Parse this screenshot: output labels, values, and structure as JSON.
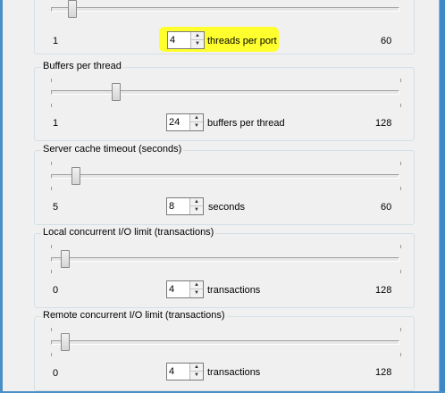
{
  "panels": [
    {
      "legend": "",
      "min": "1",
      "max": "60",
      "value": "4",
      "unit": "threads per port",
      "level": 0.05
    },
    {
      "legend": "Buffers per thread",
      "min": "1",
      "max": "128",
      "value": "24",
      "unit": "buffers per thread",
      "level": 0.18
    },
    {
      "legend": "Server cache timeout (seconds)",
      "min": "5",
      "max": "60",
      "value": "8",
      "unit": "seconds",
      "level": 0.06
    },
    {
      "legend": "Local concurrent I/O limit (transactions)",
      "min": "0",
      "max": "128",
      "value": "4",
      "unit": "transactions",
      "level": 0.03
    },
    {
      "legend": "Remote concurrent I/O limit (transactions)",
      "min": "0",
      "max": "128",
      "value": "4",
      "unit": "transactions",
      "level": 0.03
    }
  ],
  "icons": {
    "spin_up": "▲",
    "spin_down": "▼"
  },
  "colors": {
    "highlight": "#ffff2d",
    "frame": "#3d89c8"
  }
}
